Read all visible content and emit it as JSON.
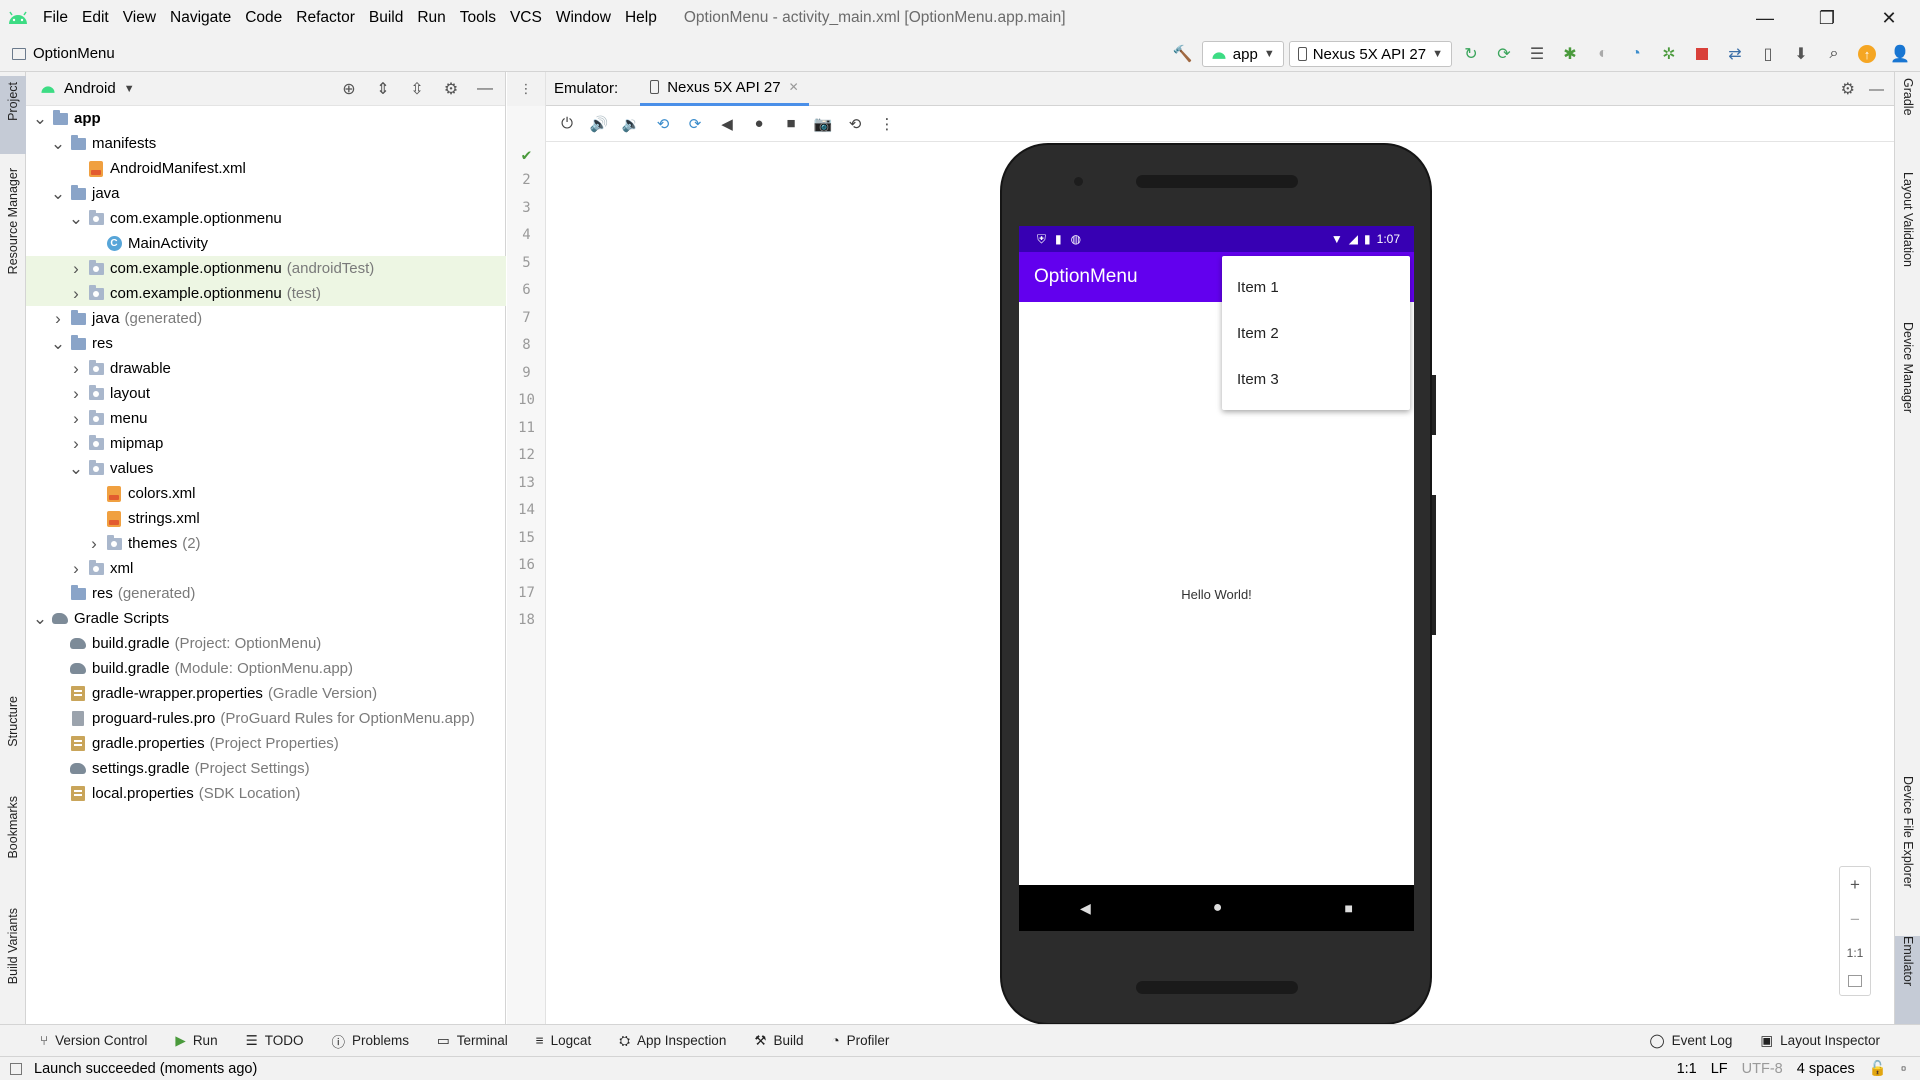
{
  "menubar": {
    "items": [
      "File",
      "Edit",
      "View",
      "Navigate",
      "Code",
      "Refactor",
      "Build",
      "Run",
      "Tools",
      "VCS",
      "Window",
      "Help"
    ],
    "window_title": "OptionMenu - activity_main.xml [OptionMenu.app.main]"
  },
  "navbar": {
    "project_name": "OptionMenu",
    "run_config": "app",
    "device": "Nexus 5X API 27"
  },
  "left_strip": [
    "Project",
    "Resource Manager",
    "Structure",
    "Bookmarks",
    "Build Variants"
  ],
  "right_strip": [
    "Gradle",
    "Layout Validation",
    "Device Manager",
    "Device File Explorer",
    "Emulator"
  ],
  "project_panel": {
    "view_mode": "Android",
    "tree": [
      {
        "label": "app",
        "sub": "",
        "indent": 0,
        "arrow": "open",
        "icon": "folder",
        "bold": true
      },
      {
        "label": "manifests",
        "sub": "",
        "indent": 1,
        "arrow": "open",
        "icon": "folder"
      },
      {
        "label": "AndroidManifest.xml",
        "sub": "",
        "indent": 2,
        "arrow": "",
        "icon": "manifest"
      },
      {
        "label": "java",
        "sub": "",
        "indent": 1,
        "arrow": "open",
        "icon": "folder"
      },
      {
        "label": "com.example.optionmenu",
        "sub": "",
        "indent": 2,
        "arrow": "open",
        "icon": "package"
      },
      {
        "label": "MainActivity",
        "sub": "",
        "indent": 3,
        "arrow": "",
        "icon": "class"
      },
      {
        "label": "com.example.optionmenu",
        "sub": "(androidTest)",
        "indent": 2,
        "arrow": "closed",
        "icon": "package",
        "hl": true
      },
      {
        "label": "com.example.optionmenu",
        "sub": "(test)",
        "indent": 2,
        "arrow": "closed",
        "icon": "package",
        "hl": true
      },
      {
        "label": "java",
        "sub": "(generated)",
        "indent": 1,
        "arrow": "closed",
        "icon": "folder"
      },
      {
        "label": "res",
        "sub": "",
        "indent": 1,
        "arrow": "open",
        "icon": "folder"
      },
      {
        "label": "drawable",
        "sub": "",
        "indent": 2,
        "arrow": "closed",
        "icon": "package"
      },
      {
        "label": "layout",
        "sub": "",
        "indent": 2,
        "arrow": "closed",
        "icon": "package"
      },
      {
        "label": "menu",
        "sub": "",
        "indent": 2,
        "arrow": "closed",
        "icon": "package"
      },
      {
        "label": "mipmap",
        "sub": "",
        "indent": 2,
        "arrow": "closed",
        "icon": "package"
      },
      {
        "label": "values",
        "sub": "",
        "indent": 2,
        "arrow": "open",
        "icon": "package"
      },
      {
        "label": "colors.xml",
        "sub": "",
        "indent": 3,
        "arrow": "",
        "icon": "xml"
      },
      {
        "label": "strings.xml",
        "sub": "",
        "indent": 3,
        "arrow": "",
        "icon": "xml"
      },
      {
        "label": "themes",
        "sub": "(2)",
        "indent": 3,
        "arrow": "closed",
        "icon": "package"
      },
      {
        "label": "xml",
        "sub": "",
        "indent": 2,
        "arrow": "closed",
        "icon": "package"
      },
      {
        "label": "res",
        "sub": "(generated)",
        "indent": 1,
        "arrow": "",
        "icon": "folder"
      },
      {
        "label": "Gradle Scripts",
        "sub": "",
        "indent": 0,
        "arrow": "open",
        "icon": "gradle"
      },
      {
        "label": "build.gradle",
        "sub": "(Project: OptionMenu)",
        "indent": 1,
        "arrow": "",
        "icon": "gradle"
      },
      {
        "label": "build.gradle",
        "sub": "(Module: OptionMenu.app)",
        "indent": 1,
        "arrow": "",
        "icon": "gradle"
      },
      {
        "label": "gradle-wrapper.properties",
        "sub": "(Gradle Version)",
        "indent": 1,
        "arrow": "",
        "icon": "props"
      },
      {
        "label": "proguard-rules.pro",
        "sub": "(ProGuard Rules for OptionMenu.app)",
        "indent": 1,
        "arrow": "",
        "icon": "file"
      },
      {
        "label": "gradle.properties",
        "sub": "(Project Properties)",
        "indent": 1,
        "arrow": "",
        "icon": "props"
      },
      {
        "label": "settings.gradle",
        "sub": "(Project Settings)",
        "indent": 1,
        "arrow": "",
        "icon": "gradle"
      },
      {
        "label": "local.properties",
        "sub": "(SDK Location)",
        "indent": 1,
        "arrow": "",
        "icon": "props"
      }
    ]
  },
  "emulator": {
    "label": "Emulator:",
    "tab": "Nexus 5X API 27",
    "line_numbers": [
      "2",
      "3",
      "4",
      "5",
      "6",
      "7",
      "8",
      "9",
      "10",
      "11",
      "12",
      "13",
      "14",
      "15",
      "16",
      "17",
      "18"
    ],
    "status_time": "1:07",
    "app_title": "OptionMenu",
    "menu_items": [
      "Item 1",
      "Item 2",
      "Item 3"
    ],
    "body_text": "Hello World!",
    "zoom_controls": [
      "+",
      "−",
      "1:1",
      "fit"
    ]
  },
  "bottom_tabs": {
    "left": [
      "Version Control",
      "Run",
      "TODO",
      "Problems",
      "Terminal",
      "Logcat",
      "App Inspection",
      "Build",
      "Profiler"
    ],
    "right": [
      "Event Log",
      "Layout Inspector"
    ]
  },
  "status_bar": {
    "message": "Launch succeeded (moments ago)",
    "position": "1:1",
    "line_sep": "LF",
    "encoding": "UTF-8",
    "indent": "4 spaces"
  },
  "colors": {
    "status_bar": "#3700b3",
    "app_bar": "#6200ee",
    "highlight_row": "#edf6e3",
    "accent_tab": "#4a8fe8"
  }
}
